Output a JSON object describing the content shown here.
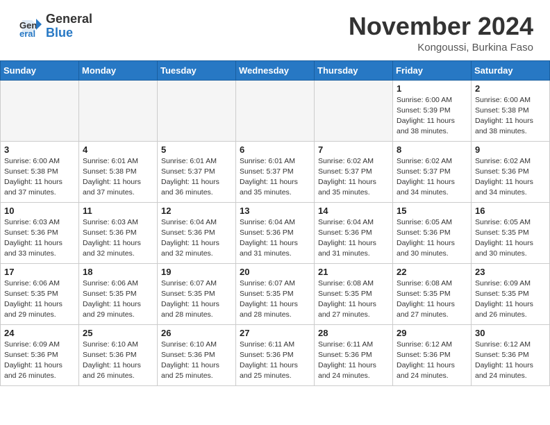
{
  "logo": {
    "general": "General",
    "blue": "Blue"
  },
  "title": "November 2024",
  "subtitle": "Kongoussi, Burkina Faso",
  "days_of_week": [
    "Sunday",
    "Monday",
    "Tuesday",
    "Wednesday",
    "Thursday",
    "Friday",
    "Saturday"
  ],
  "weeks": [
    [
      {
        "day": "",
        "empty": true
      },
      {
        "day": "",
        "empty": true
      },
      {
        "day": "",
        "empty": true
      },
      {
        "day": "",
        "empty": true
      },
      {
        "day": "",
        "empty": true
      },
      {
        "day": "1",
        "sunrise": "6:00 AM",
        "sunset": "5:39 PM",
        "daylight": "11 hours and 38 minutes."
      },
      {
        "day": "2",
        "sunrise": "6:00 AM",
        "sunset": "5:38 PM",
        "daylight": "11 hours and 38 minutes."
      }
    ],
    [
      {
        "day": "3",
        "sunrise": "6:00 AM",
        "sunset": "5:38 PM",
        "daylight": "11 hours and 37 minutes."
      },
      {
        "day": "4",
        "sunrise": "6:01 AM",
        "sunset": "5:38 PM",
        "daylight": "11 hours and 37 minutes."
      },
      {
        "day": "5",
        "sunrise": "6:01 AM",
        "sunset": "5:37 PM",
        "daylight": "11 hours and 36 minutes."
      },
      {
        "day": "6",
        "sunrise": "6:01 AM",
        "sunset": "5:37 PM",
        "daylight": "11 hours and 35 minutes."
      },
      {
        "day": "7",
        "sunrise": "6:02 AM",
        "sunset": "5:37 PM",
        "daylight": "11 hours and 35 minutes."
      },
      {
        "day": "8",
        "sunrise": "6:02 AM",
        "sunset": "5:37 PM",
        "daylight": "11 hours and 34 minutes."
      },
      {
        "day": "9",
        "sunrise": "6:02 AM",
        "sunset": "5:36 PM",
        "daylight": "11 hours and 34 minutes."
      }
    ],
    [
      {
        "day": "10",
        "sunrise": "6:03 AM",
        "sunset": "5:36 PM",
        "daylight": "11 hours and 33 minutes."
      },
      {
        "day": "11",
        "sunrise": "6:03 AM",
        "sunset": "5:36 PM",
        "daylight": "11 hours and 32 minutes."
      },
      {
        "day": "12",
        "sunrise": "6:04 AM",
        "sunset": "5:36 PM",
        "daylight": "11 hours and 32 minutes."
      },
      {
        "day": "13",
        "sunrise": "6:04 AM",
        "sunset": "5:36 PM",
        "daylight": "11 hours and 31 minutes."
      },
      {
        "day": "14",
        "sunrise": "6:04 AM",
        "sunset": "5:36 PM",
        "daylight": "11 hours and 31 minutes."
      },
      {
        "day": "15",
        "sunrise": "6:05 AM",
        "sunset": "5:36 PM",
        "daylight": "11 hours and 30 minutes."
      },
      {
        "day": "16",
        "sunrise": "6:05 AM",
        "sunset": "5:35 PM",
        "daylight": "11 hours and 30 minutes."
      }
    ],
    [
      {
        "day": "17",
        "sunrise": "6:06 AM",
        "sunset": "5:35 PM",
        "daylight": "11 hours and 29 minutes."
      },
      {
        "day": "18",
        "sunrise": "6:06 AM",
        "sunset": "5:35 PM",
        "daylight": "11 hours and 29 minutes."
      },
      {
        "day": "19",
        "sunrise": "6:07 AM",
        "sunset": "5:35 PM",
        "daylight": "11 hours and 28 minutes."
      },
      {
        "day": "20",
        "sunrise": "6:07 AM",
        "sunset": "5:35 PM",
        "daylight": "11 hours and 28 minutes."
      },
      {
        "day": "21",
        "sunrise": "6:08 AM",
        "sunset": "5:35 PM",
        "daylight": "11 hours and 27 minutes."
      },
      {
        "day": "22",
        "sunrise": "6:08 AM",
        "sunset": "5:35 PM",
        "daylight": "11 hours and 27 minutes."
      },
      {
        "day": "23",
        "sunrise": "6:09 AM",
        "sunset": "5:35 PM",
        "daylight": "11 hours and 26 minutes."
      }
    ],
    [
      {
        "day": "24",
        "sunrise": "6:09 AM",
        "sunset": "5:36 PM",
        "daylight": "11 hours and 26 minutes."
      },
      {
        "day": "25",
        "sunrise": "6:10 AM",
        "sunset": "5:36 PM",
        "daylight": "11 hours and 26 minutes."
      },
      {
        "day": "26",
        "sunrise": "6:10 AM",
        "sunset": "5:36 PM",
        "daylight": "11 hours and 25 minutes."
      },
      {
        "day": "27",
        "sunrise": "6:11 AM",
        "sunset": "5:36 PM",
        "daylight": "11 hours and 25 minutes."
      },
      {
        "day": "28",
        "sunrise": "6:11 AM",
        "sunset": "5:36 PM",
        "daylight": "11 hours and 24 minutes."
      },
      {
        "day": "29",
        "sunrise": "6:12 AM",
        "sunset": "5:36 PM",
        "daylight": "11 hours and 24 minutes."
      },
      {
        "day": "30",
        "sunrise": "6:12 AM",
        "sunset": "5:36 PM",
        "daylight": "11 hours and 24 minutes."
      }
    ]
  ]
}
